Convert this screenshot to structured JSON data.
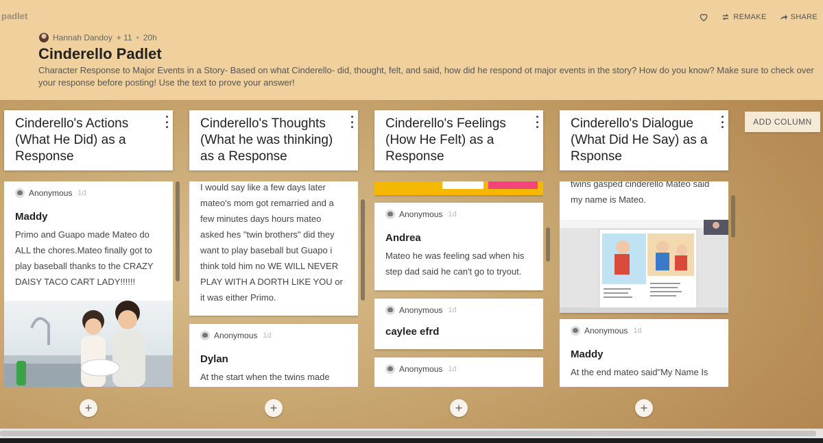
{
  "app": {
    "logo": "padlet"
  },
  "header": {
    "remake_label": "REMAKE",
    "share_label": "SHARE",
    "author": "Hannah Dandoy",
    "plus_count": "+ 11",
    "age": "20h",
    "title": "Cinderello Padlet",
    "description": "Character Response to Major Events in a Story- Based on what Cinderello- did, thought, felt, and said, how did he respond ot major events in the story? How do you know? Make sure to check over your response before posting! Use the text to prove your answer!"
  },
  "add_column_label": "ADD COLUMN",
  "add_post_glyph": "+",
  "columns": [
    {
      "title": "Cinderello's Actions (What He Did) as a Response",
      "posts": [
        {
          "author": "Anonymous",
          "time": "1d",
          "title": "Maddy",
          "text": "Primo and Guapo made Mateo do ALL the chores.Mateo finally got to play baseball thanks to the CRAZY DAISY TACO CART LADY!!!!!!"
        }
      ]
    },
    {
      "title": "Cinderello's Thoughts (What he was thinking) as a Response",
      "posts": [
        {
          "text": "I would say like a few days later mateo's mom got remarried and a few minutes days hours mateo asked hes \"twin brothers\" did they want to play baseball but Guapo i think told him no WE WILL NEVER PLAY WITH A DORTH LIKE YOU or it was either Primo."
        },
        {
          "author": "Anonymous",
          "time": "1d",
          "title": "Dylan",
          "text": "At the start when the twins made"
        }
      ]
    },
    {
      "title": "Cinderello's Feelings (How He Felt) as a Response",
      "posts": [
        {
          "author": "Anonymous",
          "time": "1d",
          "title": "Andrea",
          "text": "Mateo he was feeling  sad when his step dad said he can't go to tryout."
        },
        {
          "author": "Anonymous",
          "time": "1d",
          "title": "caylee efrd"
        },
        {
          "author": "Anonymous",
          "time": "1d"
        }
      ]
    },
    {
      "title": "Cinderello's Dialogue (What Did He Say) as a Rsponse",
      "posts": [
        {
          "text": "twins gasped cinderello Mateo said my name is Mateo."
        },
        {
          "author": "Anonymous",
          "time": "1d",
          "title": "Maddy",
          "text": "At the end mateo said\"My Name Is"
        }
      ]
    }
  ],
  "colors": {
    "header_bg": "#f0d09c",
    "card_bg": "#ffffff",
    "accent_yellow": "#f5b800",
    "accent_pink": "#f2457e"
  }
}
